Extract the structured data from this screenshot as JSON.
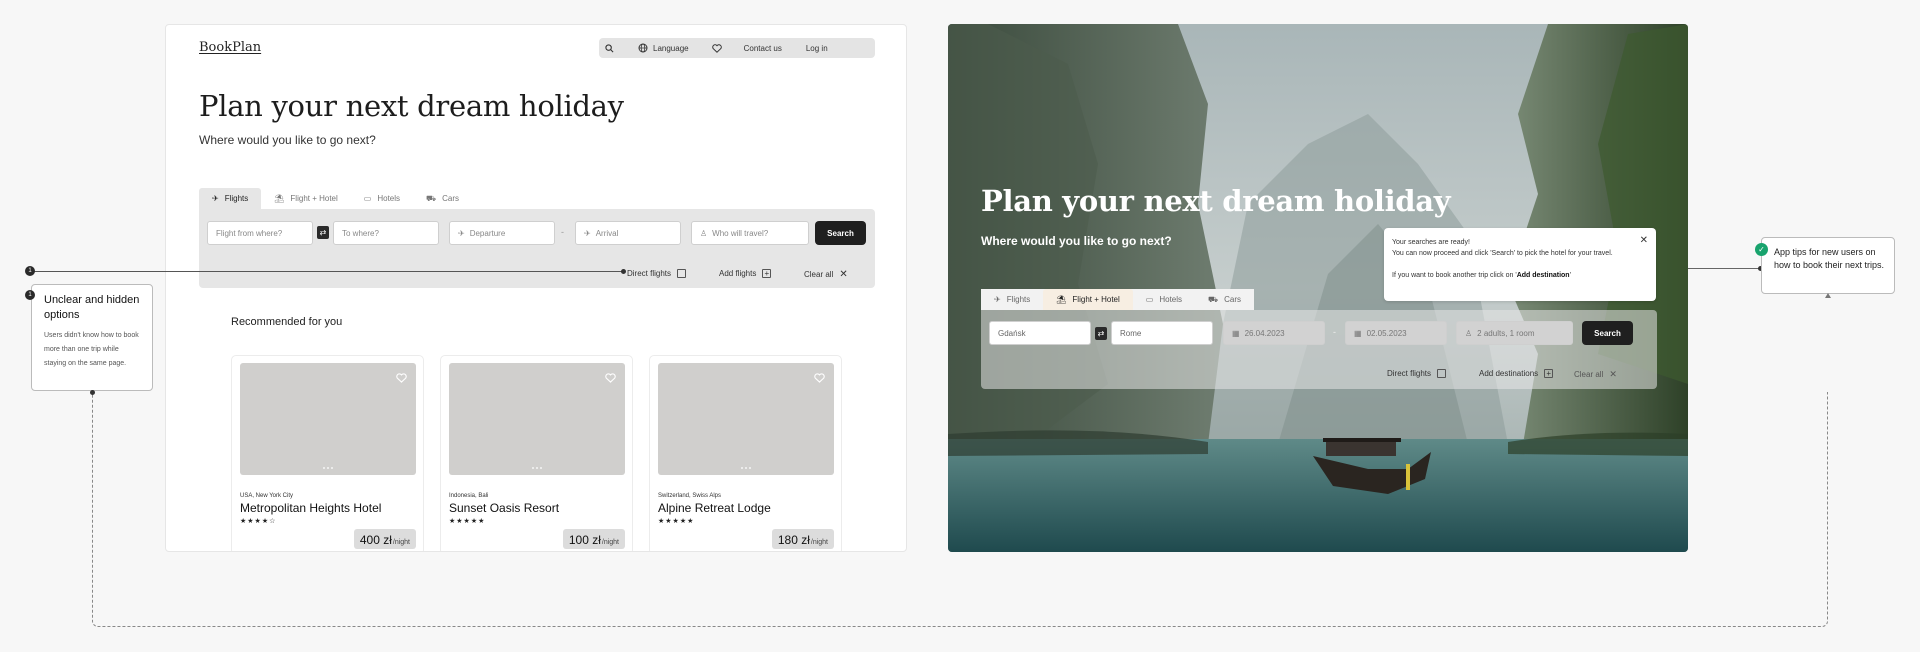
{
  "left_mockup": {
    "logo": "BookPlan",
    "nav": {
      "language": "Language",
      "contact": "Contact us",
      "login": "Log in"
    },
    "hero": {
      "title": "Plan your next dream holiday",
      "subtitle": "Where would you like to go next?"
    },
    "tabs": [
      "Flights",
      "Flight + Hotel",
      "Hotels",
      "Cars"
    ],
    "active_tab": "Flights",
    "fields": {
      "from_placeholder": "Flight from where?",
      "to_placeholder": "To where?",
      "departure_placeholder": "Departure",
      "arrival_placeholder": "Arrival",
      "travelers_placeholder": "Who will travel?"
    },
    "date_separator": "-",
    "search_label": "Search",
    "options": {
      "direct_flights": "Direct flights",
      "add_flights": "Add flights",
      "clear_all": "Clear all"
    },
    "recommended_title": "Recommended for you",
    "cards": [
      {
        "location": "USA, New York City",
        "name": "Metropolitan Heights Hotel",
        "stars": "★★★★☆",
        "rating": 4,
        "price": "400 zł",
        "unit": "/night"
      },
      {
        "location": "Indonesia, Bali",
        "name": "Sunset Oasis Resort",
        "stars": "★★★★★",
        "rating": 5,
        "price": "100 zł",
        "unit": "/night"
      },
      {
        "location": "Switzerland, Swiss Alps",
        "name": "Alpine Retreat Lodge",
        "stars": "★★★★★",
        "rating": 5,
        "price": "180 zł",
        "unit": "/night"
      }
    ]
  },
  "annotation_left": {
    "number": "1",
    "title": "Unclear and hidden options",
    "body": "Users didn't know how to book more than one trip while staying on the same page."
  },
  "right_mockup": {
    "hero": {
      "title": "Plan your next dream holiday",
      "subtitle": "Where would you like to go next?"
    },
    "tabs": [
      "Flights",
      "Flight + Hotel",
      "Hotels",
      "Cars"
    ],
    "active_tab": "Flight + Hotel",
    "fields": {
      "from_value": "Gdańsk",
      "to_value": "Rome",
      "departure_value": "26.04.2023",
      "arrival_value": "02.05.2023",
      "travelers_value": "2 adults, 1 room"
    },
    "date_separator": "-",
    "search_label": "Search",
    "options": {
      "direct_flights": "Direct flights",
      "add_destinations": "Add destinations",
      "clear_all": "Clear all"
    },
    "toast": {
      "line1": "Your searches are ready!",
      "line2": "You can now proceed and click 'Search' to pick the hotel for your travel.",
      "line3_prefix": "If you want to book another trip click on '",
      "line3_bold": "Add destination",
      "line3_suffix": "'"
    }
  },
  "annotation_right": {
    "text": "App tips for new users on how to book their next trips."
  },
  "colors": {
    "accent_dark": "#1f1f1f",
    "success": "#18a36d",
    "active_tab_warm": "#f7eee2",
    "placeholder_image": "#d0cfcd"
  }
}
